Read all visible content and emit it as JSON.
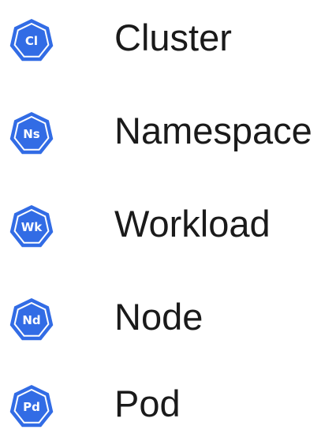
{
  "colors": {
    "badge_fill": "#326ce5",
    "badge_border": "#ffffff",
    "badge_text": "#ffffff",
    "label_text": "#1a1a1a"
  },
  "icon_shape": "heptagon-badge",
  "items": [
    {
      "abbr": "Cl",
      "label": "Cluster"
    },
    {
      "abbr": "Ns",
      "label": "Namespace"
    },
    {
      "abbr": "Wk",
      "label": "Workload"
    },
    {
      "abbr": "Nd",
      "label": "Node"
    },
    {
      "abbr": "Pd",
      "label": "Pod"
    }
  ]
}
